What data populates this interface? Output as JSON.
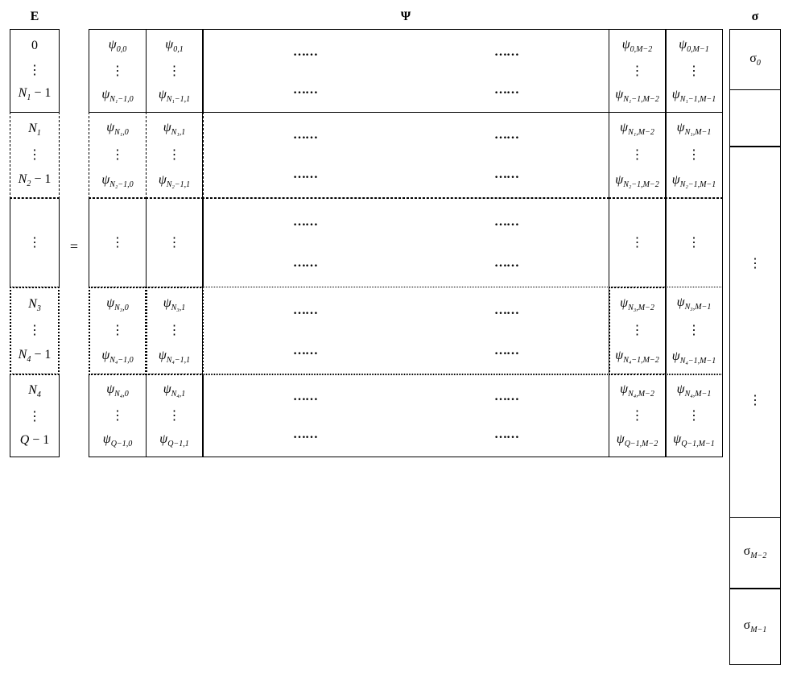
{
  "headers": {
    "E": "E",
    "Psi": "Ψ",
    "sigma": "σ"
  },
  "equals": "=",
  "hdots": "……",
  "vdots": "⋮",
  "E_blocks": [
    {
      "top": "0",
      "bot": "N₁ − 1",
      "style": "solid"
    },
    {
      "top": "N₁",
      "bot": "N₂ − 1",
      "style": "dashed"
    },
    {
      "top": "⋮",
      "bot": "⋮",
      "style": "vdots"
    },
    {
      "top": "N₃",
      "bot": "N₄ − 1",
      "style": "dotted"
    },
    {
      "top": "N₄",
      "bot": "Q − 1",
      "style": "solid"
    }
  ],
  "Psi_rows": [
    {
      "style": "solid",
      "t": [
        "ψ_{0,0}",
        "ψ_{0,1}",
        "ψ_{0,M−2}",
        "ψ_{0,M−1}"
      ],
      "b": [
        "ψ_{N₁−1,0}",
        "ψ_{N₁−1,1}",
        "ψ_{N₁−1,M−2}",
        "ψ_{N₁−1,M−1}"
      ]
    },
    {
      "style": "dashed",
      "t": [
        "ψ_{N₁,0}",
        "ψ_{N₁,1}",
        "ψ_{N₁,M−2}",
        "ψ_{N₁,M−1}"
      ],
      "b": [
        "ψ_{N₂−1,0}",
        "ψ_{N₂−1,1}",
        "ψ_{N₂−1,M−2}",
        "ψ_{N₂−1,M−1}"
      ]
    },
    {
      "style": "vdots"
    },
    {
      "style": "dotted",
      "t": [
        "ψ_{N₃,0}",
        "ψ_{N₃,1}",
        "ψ_{N₃,M−2}",
        "ψ_{N₃,M−1}"
      ],
      "b": [
        "ψ_{N₄−1,0}",
        "ψ_{N₄−1,1}",
        "ψ_{N₄−1,M−2}",
        "ψ_{N₄−1,M−1}"
      ]
    },
    {
      "style": "solid",
      "t": [
        "ψ_{N₄,0}",
        "ψ_{N₄,1}",
        "ψ_{N₄,M−2}",
        "ψ_{N₄,M−1}"
      ],
      "b": [
        "ψ_{Q−1,0}",
        "ψ_{Q−1,1}",
        "ψ_{Q−1,M−2}",
        "ψ_{Q−1,M−1}"
      ]
    }
  ],
  "sigma_blocks": [
    "σ₀",
    "",
    "⋮⋮",
    "σ_{M−2}",
    "σ_{M−1}"
  ],
  "psi_render": {
    "r0": {
      "t0": {
        "base": "ψ",
        "sub": "0,0"
      },
      "t1": {
        "base": "ψ",
        "sub": "0,1"
      },
      "t2": {
        "base": "ψ",
        "sub": "0,M−2"
      },
      "t3": {
        "base": "ψ",
        "sub": "0,M−1"
      },
      "b0": {
        "base": "ψ",
        "sub": "N₁−1,0"
      },
      "b1": {
        "base": "ψ",
        "sub": "N₁−1,1"
      },
      "b2": {
        "base": "ψ",
        "sub": "N₁−1,M−2"
      },
      "b3": {
        "base": "ψ",
        "sub": "N₁−1,M−1"
      }
    },
    "r1": {
      "t0": {
        "base": "ψ",
        "sub": "N₁,0"
      },
      "t1": {
        "base": "ψ",
        "sub": "N₁,1"
      },
      "t2": {
        "base": "ψ",
        "sub": "N₁,M−2"
      },
      "t3": {
        "base": "ψ",
        "sub": "N₁,M−1"
      },
      "b0": {
        "base": "ψ",
        "sub": "N₂−1,0"
      },
      "b1": {
        "base": "ψ",
        "sub": "N₂−1,1"
      },
      "b2": {
        "base": "ψ",
        "sub": "N₂−1,M−2"
      },
      "b3": {
        "base": "ψ",
        "sub": "N₂−1,M−1"
      }
    },
    "r3": {
      "t0": {
        "base": "ψ",
        "sub": "N₃,0"
      },
      "t1": {
        "base": "ψ",
        "sub": "N₃,1"
      },
      "t2": {
        "base": "ψ",
        "sub": "N₃,M−2"
      },
      "t3": {
        "base": "ψ",
        "sub": "N₃,M−1"
      },
      "b0": {
        "base": "ψ",
        "sub": "N₄−1,0"
      },
      "b1": {
        "base": "ψ",
        "sub": "N₄−1,1"
      },
      "b2": {
        "base": "ψ",
        "sub": "N₄−1,M−2"
      },
      "b3": {
        "base": "ψ",
        "sub": "N₄−1,M−1"
      }
    },
    "r4": {
      "t0": {
        "base": "ψ",
        "sub": "N₄,0"
      },
      "t1": {
        "base": "ψ",
        "sub": "N₄,1"
      },
      "t2": {
        "base": "ψ",
        "sub": "N₄,M−2"
      },
      "t3": {
        "base": "ψ",
        "sub": "N₄,M−1"
      },
      "b0": {
        "base": "ψ",
        "sub": "Q−1,0"
      },
      "b1": {
        "base": "ψ",
        "sub": "Q−1,1"
      },
      "b2": {
        "base": "ψ",
        "sub": "Q−1,M−2"
      },
      "b3": {
        "base": "ψ",
        "sub": "Q−1,M−1"
      }
    }
  },
  "E_render": {
    "r0": {
      "top": "0",
      "bot_base": "N",
      "bot_sub": "1",
      "bot_tail": " − 1"
    },
    "r1": {
      "top_base": "N",
      "top_sub": "1",
      "bot_base": "N",
      "bot_sub": "2",
      "bot_tail": " − 1"
    },
    "r3": {
      "top_base": "N",
      "top_sub": "3",
      "bot_base": "N",
      "bot_sub": "4",
      "bot_tail": " − 1"
    },
    "r4": {
      "top_base": "N",
      "top_sub": "4",
      "bot_base": "Q",
      "bot_sub": "",
      "bot_tail": " − 1"
    }
  },
  "sigma_render": {
    "s0": {
      "base": "σ",
      "sub": "0"
    },
    "s3": {
      "base": "σ",
      "sub": "M−2"
    },
    "s4": {
      "base": "σ",
      "sub": "M−1"
    }
  }
}
